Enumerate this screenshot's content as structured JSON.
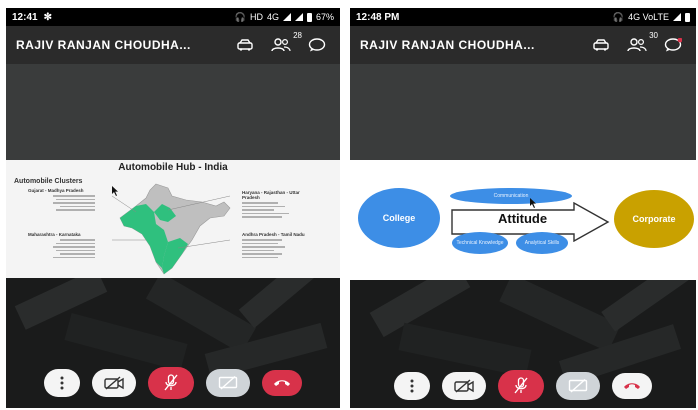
{
  "left_screen": {
    "status": {
      "time": "12:41",
      "network": "HD",
      "signal": "4G",
      "battery": "67%"
    },
    "title": "RAJIV RANJAN CHOUDHA...",
    "participants_count": "28",
    "slide": {
      "title": "Automobile Hub - India",
      "subtitle": "Automobile Clusters",
      "regions": [
        {
          "name": "Gujarat - Madhya Pradesh"
        },
        {
          "name": "Haryana - Rajasthan - Uttar Pradesh"
        },
        {
          "name": "Maharashtra - Karnataka"
        },
        {
          "name": "Andhra Pradesh - Tamil Nadu"
        }
      ]
    }
  },
  "right_screen": {
    "status": {
      "time": "12:48 PM",
      "signal": "4G VoLTE"
    },
    "title": "RAJIV RANJAN CHOUDHA...",
    "participants_count": "30",
    "slide": {
      "left_circle": "College",
      "center": "Attitude",
      "right_circle": "Corporate",
      "top_ellipse": "Communication",
      "bottom_left_ellipse": "Technical Knowledge",
      "bottom_right_ellipse": "Analytical Skills"
    }
  },
  "colors": {
    "end_call": "#d8324a",
    "map_green": "#2fc07e",
    "college_blue": "#3d8ee6",
    "corporate_gold": "#c9a100"
  }
}
